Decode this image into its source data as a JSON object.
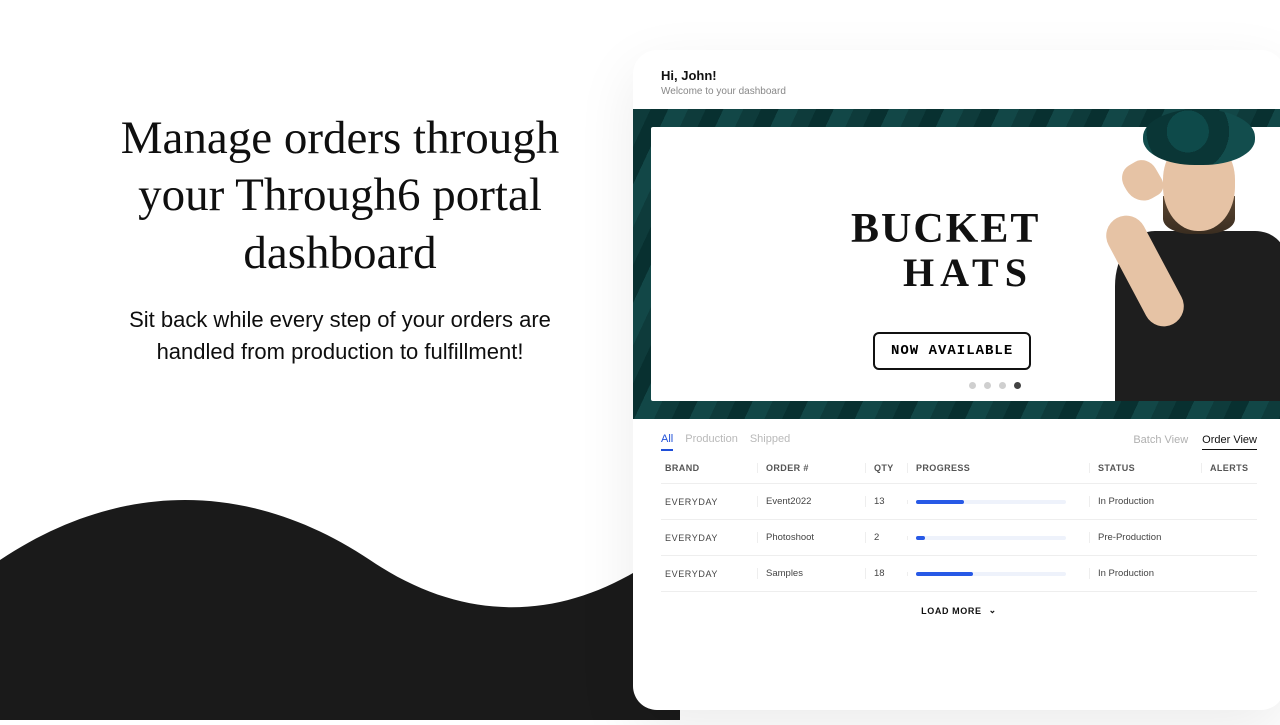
{
  "promo": {
    "headline": "Manage orders through your Through6 portal dashboard",
    "sub": "Sit back while every step of your orders are handled from production to fulfillment!"
  },
  "greeting": {
    "title": "Hi, John!",
    "sub": "Welcome to your dashboard"
  },
  "hero": {
    "line1": "BUCKET",
    "line2": "HATS",
    "cta": "NOW AVAILABLE"
  },
  "orders": {
    "filters": {
      "all": "All",
      "production": "Production",
      "shipped": "Shipped"
    },
    "views": {
      "batch": "Batch View",
      "order": "Order View"
    },
    "columns": {
      "brand": "BRAND",
      "order": "ORDER #",
      "qty": "QTY",
      "progress": "PROGRESS",
      "status": "STATUS",
      "alerts": "ALERTS"
    },
    "rows": [
      {
        "brand": "EVERYDAY",
        "order": "Event2022",
        "qty": "13",
        "progress": 32,
        "status": "In Production"
      },
      {
        "brand": "EVERYDAY",
        "order": "Photoshoot",
        "qty": "2",
        "progress": 6,
        "status": "Pre-Production"
      },
      {
        "brand": "EVERYDAY",
        "order": "Samples",
        "qty": "18",
        "progress": 38,
        "status": "In Production"
      }
    ],
    "load_more": "LOAD MORE"
  }
}
